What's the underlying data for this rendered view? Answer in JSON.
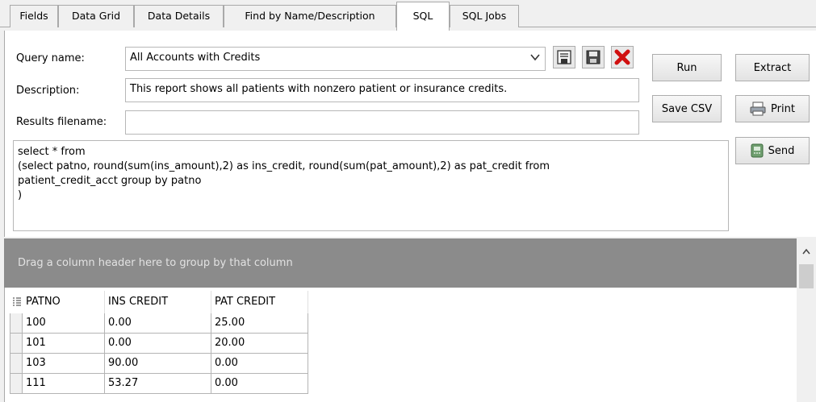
{
  "tabs": [
    {
      "label": "Fields"
    },
    {
      "label": "Data Grid"
    },
    {
      "label": "Data Details"
    },
    {
      "label": "Find by Name/Description"
    },
    {
      "label": "SQL"
    },
    {
      "label": "SQL Jobs"
    }
  ],
  "form": {
    "query_name_label": "Query name:",
    "query_name_value": "All Accounts with Credits",
    "description_label": "Description:",
    "description_value": "This report shows all patients with nonzero patient or insurance credits.",
    "results_filename_label": "Results filename:",
    "results_filename_value": "",
    "sql_text": "select * from\n(select patno, round(sum(ins_amount),2) as ins_credit, round(sum(pat_amount),2) as pat_credit from\npatient_credit_acct group by patno\n)"
  },
  "buttons": {
    "run": "Run",
    "extract": "Extract",
    "save_csv": "Save CSV",
    "print": "Print",
    "send": "Send"
  },
  "grid": {
    "group_hint": "Drag a column header here to group by that column",
    "columns": [
      "PATNO",
      "INS CREDIT",
      "PAT CREDIT"
    ],
    "rows": [
      [
        "100",
        "0.00",
        "25.00"
      ],
      [
        "101",
        "0.00",
        "20.00"
      ],
      [
        "103",
        "90.00",
        "0.00"
      ],
      [
        "111",
        "53.27",
        "0.00"
      ]
    ]
  },
  "colors": {
    "group_bar": "#8b8b8b",
    "delete_icon": "#d01010"
  }
}
